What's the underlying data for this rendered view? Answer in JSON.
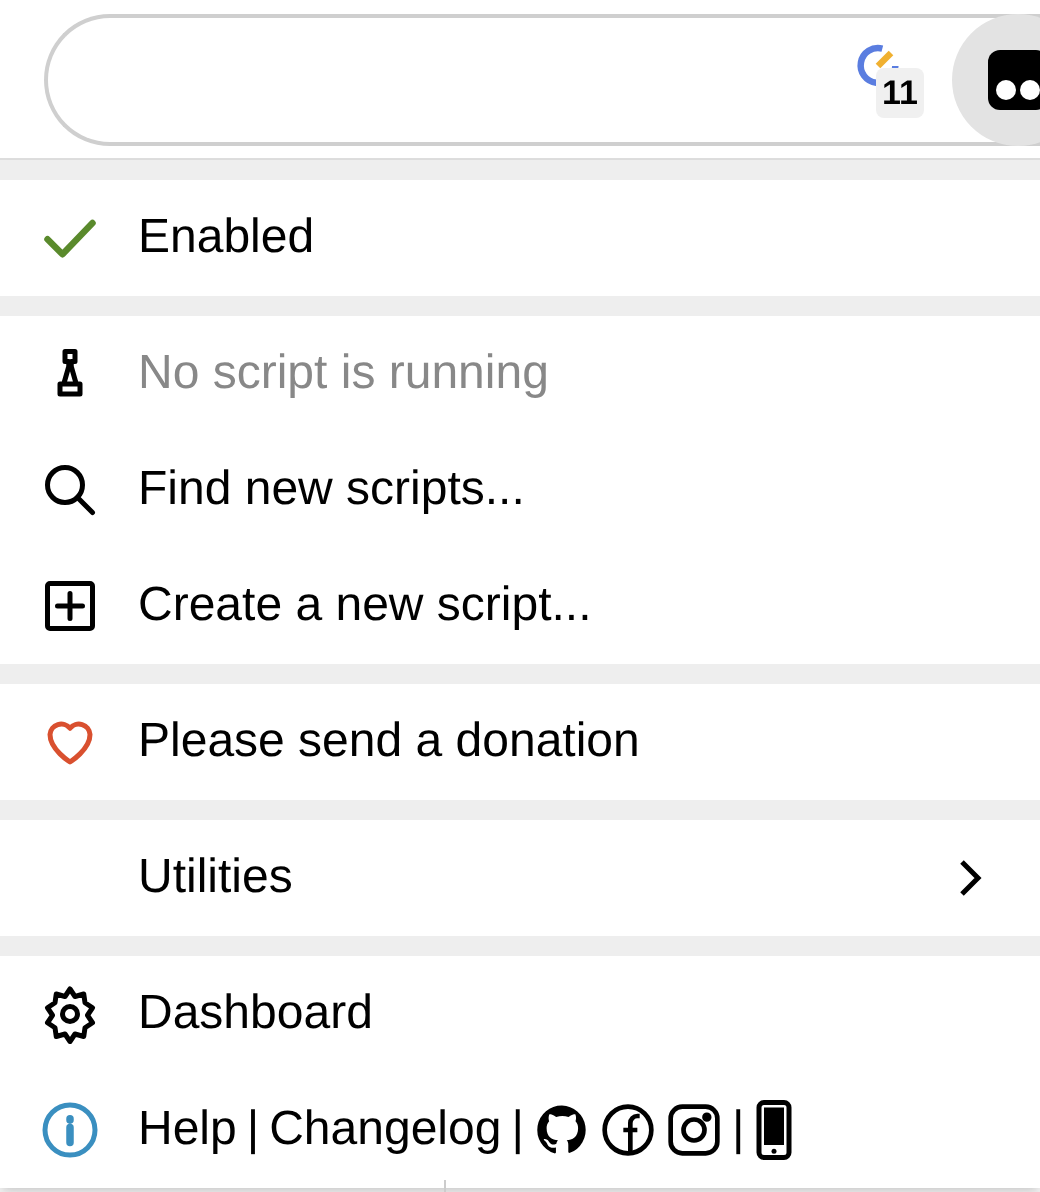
{
  "toolbar": {
    "badge": "11"
  },
  "sections": [
    {
      "items": [
        {
          "kind": "toggle",
          "label": "Enabled",
          "checked": true
        }
      ]
    },
    {
      "items": [
        {
          "kind": "status",
          "label": "No script is running",
          "disabled": true
        },
        {
          "kind": "action",
          "label": "Find new scripts..."
        },
        {
          "kind": "action",
          "label": "Create a new script..."
        }
      ]
    },
    {
      "items": [
        {
          "kind": "action",
          "label": "Please send a donation"
        }
      ]
    },
    {
      "items": [
        {
          "kind": "submenu",
          "label": "Utilities"
        }
      ]
    },
    {
      "items": [
        {
          "kind": "action",
          "label": "Dashboard"
        },
        {
          "kind": "links",
          "parts": [
            {
              "kind": "link",
              "text": "Help"
            },
            {
              "kind": "sep",
              "text": "|"
            },
            {
              "kind": "link",
              "text": "Changelog"
            },
            {
              "kind": "sep",
              "text": "|"
            },
            {
              "kind": "social"
            },
            {
              "kind": "social"
            },
            {
              "kind": "social"
            },
            {
              "kind": "sep",
              "text": "|"
            },
            {
              "kind": "social"
            }
          ]
        }
      ]
    }
  ]
}
